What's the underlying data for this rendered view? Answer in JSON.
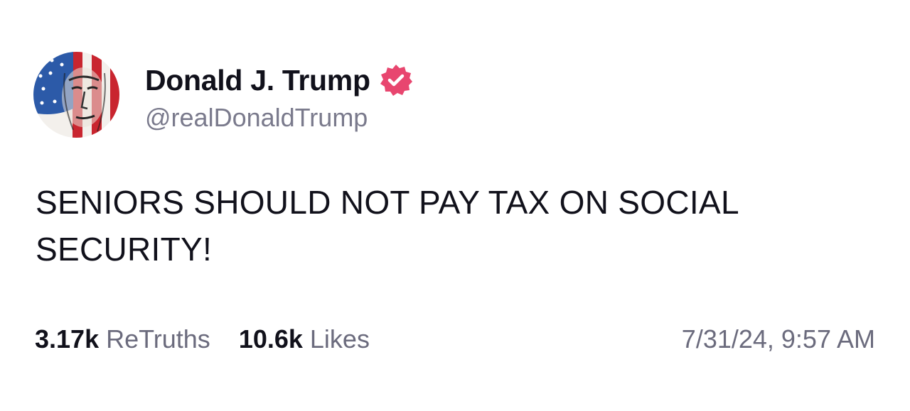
{
  "author": {
    "display_name": "Donald J. Trump",
    "handle": "@realDonaldTrump",
    "verified": true,
    "verified_badge_color": "#e8466f",
    "avatar_icon": "flag-portrait-avatar"
  },
  "post": {
    "text": "SENIORS SHOULD NOT PAY TAX ON SOCIAL SECURITY!"
  },
  "stats": {
    "retruths_count": "3.17k",
    "retruths_label": "ReTruths",
    "likes_count": "10.6k",
    "likes_label": "Likes"
  },
  "timestamp": "7/31/24, 9:57 AM",
  "colors": {
    "text_primary": "#11111b",
    "text_secondary": "#6b6b7d",
    "background": "#ffffff"
  }
}
